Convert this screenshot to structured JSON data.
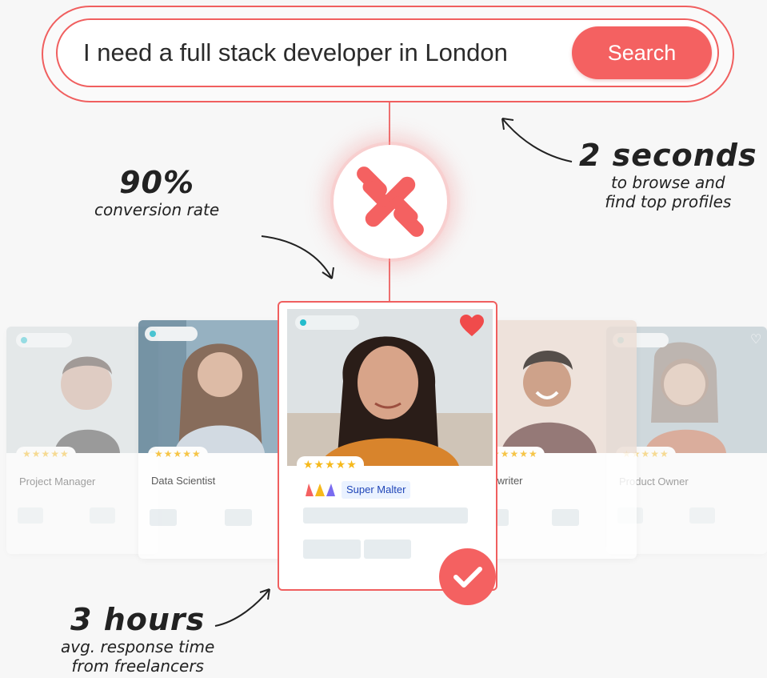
{
  "search": {
    "query": "I need a full stack developer in London",
    "button_label": "Search"
  },
  "annotations": {
    "speed_big": "2 seconds",
    "speed_line1": "to browse and",
    "speed_line2": "find top profiles",
    "conversion_big": "90%",
    "conversion_small": "conversion rate",
    "response_big": "3 hours",
    "response_line1": "avg. response time",
    "response_line2": "from freelancers"
  },
  "cards": [
    {
      "role": "Project Manager",
      "stars": "★★★★★"
    },
    {
      "role": "Data Scientist",
      "stars": "★★★★★"
    },
    {
      "role": "pywriter",
      "stars": "★★★★★"
    },
    {
      "role": "Product Owner",
      "stars": "★★★★★"
    }
  ],
  "featured": {
    "stars": "★★★★★",
    "badge": "Super Malter",
    "favorite_icon": "heart-icon",
    "check_icon": "check-icon"
  },
  "colors": {
    "accent": "#f46161",
    "badge_text": "#2046b8",
    "star": "#f6b91c",
    "status_dot": "#23bccc"
  }
}
